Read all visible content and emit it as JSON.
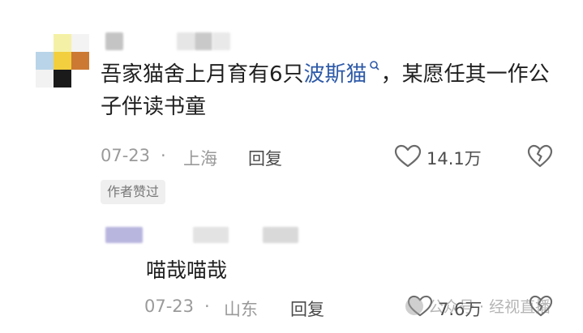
{
  "comment": {
    "text_before": "吾家猫舍上月育有6只",
    "topic": "波斯猫",
    "text_after": "，某愿任其一作公子伴读书童",
    "date": "07-23",
    "separator": "·",
    "location": "上海",
    "reply_label": "回复",
    "likes": "14.1万",
    "badge": "作者赞过"
  },
  "reply": {
    "text": "喵哉喵哉",
    "date": "07-23",
    "separator": "·",
    "location": "山东",
    "reply_label": "回复",
    "likes": "7.6万"
  },
  "watermark": {
    "text": "公众号 · 经视直播"
  },
  "colors": {
    "text": "#1f1f1f",
    "meta": "#9a9a9a",
    "link": "#2e5aa8",
    "badge_bg": "#efefef"
  }
}
